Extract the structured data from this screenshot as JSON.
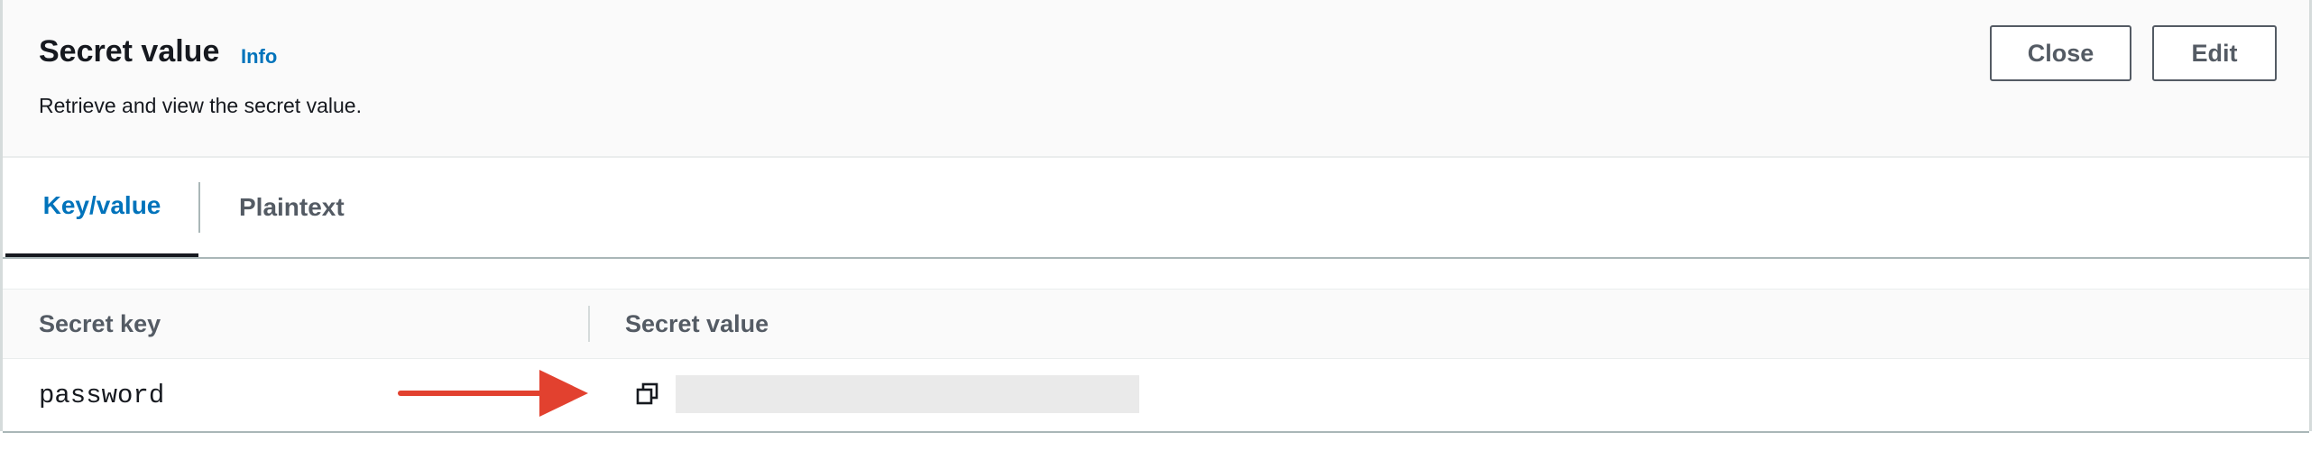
{
  "header": {
    "title": "Secret value",
    "info_link": "Info",
    "subtitle": "Retrieve and view the secret value.",
    "buttons": {
      "close": "Close",
      "edit": "Edit"
    }
  },
  "tabs": [
    {
      "label": "Key/value",
      "active": true
    },
    {
      "label": "Plaintext",
      "active": false
    }
  ],
  "table": {
    "columns": [
      "Secret key",
      "Secret value"
    ],
    "rows": [
      {
        "key": "password",
        "value_masked": true
      }
    ]
  },
  "icons": {
    "copy": "copy-icon",
    "annotation": "red-arrow-annotation"
  },
  "colors": {
    "accent": "#0073bb",
    "annotation": "#e2412f",
    "masked": "#eaeaea"
  }
}
